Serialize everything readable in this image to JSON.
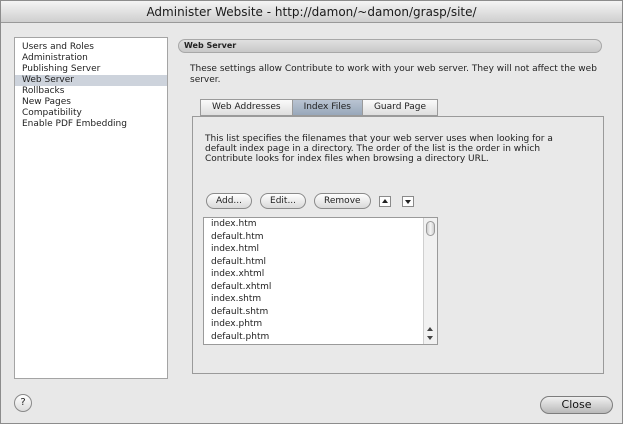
{
  "window": {
    "title": "Administer Website - http://damon/~damon/grasp/site/"
  },
  "sidebar": {
    "items": [
      {
        "label": "Users and Roles"
      },
      {
        "label": "Administration"
      },
      {
        "label": "Publishing Server"
      },
      {
        "label": "Web Server",
        "selected": true
      },
      {
        "label": "Rollbacks"
      },
      {
        "label": "New Pages"
      },
      {
        "label": "Compatibility"
      },
      {
        "label": "Enable PDF Embedding"
      }
    ]
  },
  "main": {
    "section_title": "Web Server",
    "description": "These settings allow Contribute to work with your web server. They will not affect the web server.",
    "tabs": [
      {
        "label": "Web Addresses"
      },
      {
        "label": "Index Files",
        "active": true
      },
      {
        "label": "Guard Page"
      }
    ],
    "index_files": {
      "description": "This list specifies the filenames that your web server uses when looking for a default index page in a directory. The order of the list is the order in which Contribute looks for index files when browsing a directory URL.",
      "buttons": {
        "add": "Add...",
        "edit": "Edit...",
        "remove": "Remove",
        "move_up_icon": "triangle-up",
        "move_down_icon": "triangle-down"
      },
      "files": [
        "index.htm",
        "default.htm",
        "index.html",
        "default.html",
        "index.xhtml",
        "default.xhtml",
        "index.shtm",
        "default.shtm",
        "index.phtm",
        "default.phtm"
      ]
    }
  },
  "footer": {
    "help_label": "?",
    "close_label": "Close"
  }
}
